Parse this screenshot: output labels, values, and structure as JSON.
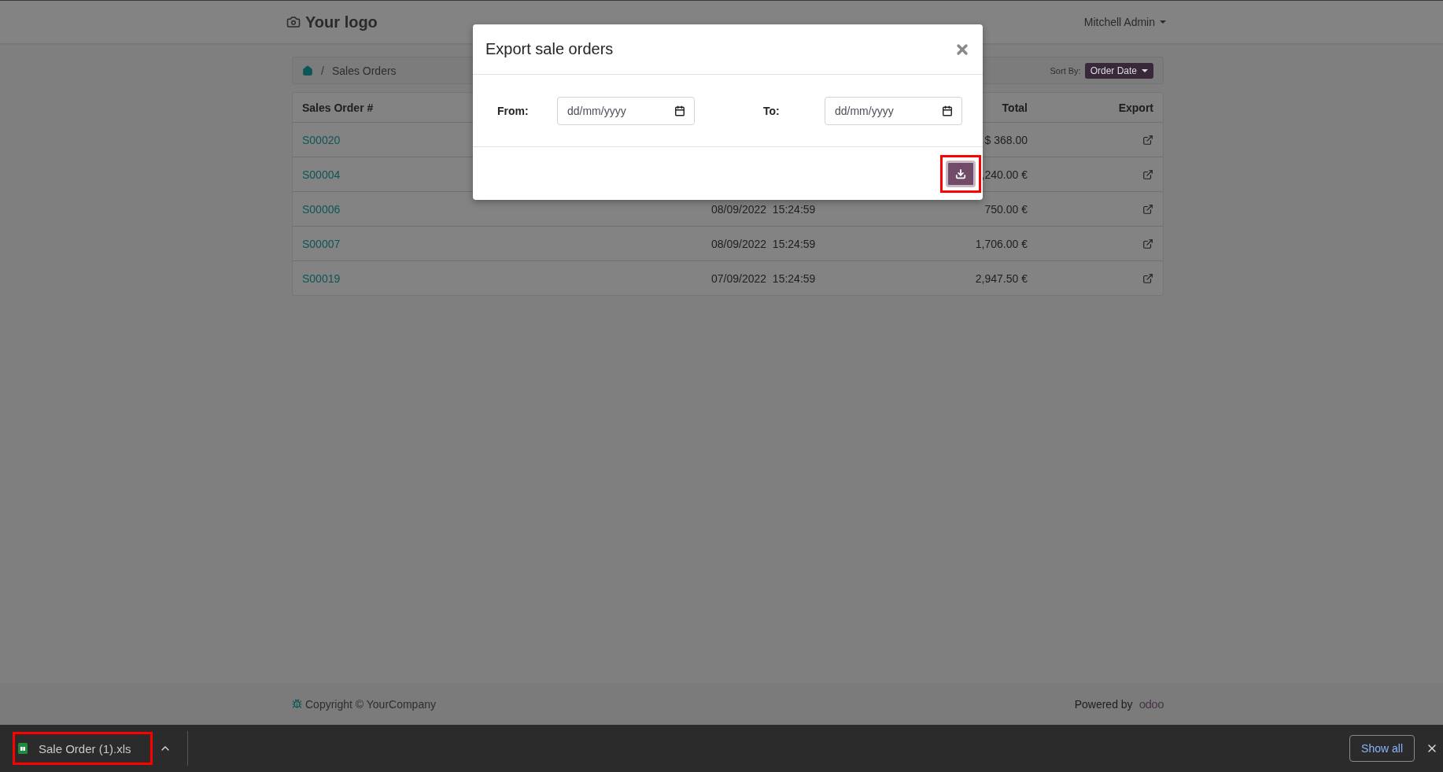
{
  "header": {
    "logo": "Your logo",
    "user": "Mitchell Admin"
  },
  "breadcrumb": {
    "separator": "/",
    "items": [
      "Sales Orders"
    ],
    "sort_label": "Sort By:",
    "sort_value": "Order Date"
  },
  "table": {
    "columns": {
      "order": "Sales Order #",
      "total": "Total",
      "export": "Export"
    },
    "rows": [
      {
        "order": "S00020",
        "total": "$ 368.00"
      },
      {
        "order": "S00004",
        "total": ",240.00 €"
      },
      {
        "order": "S00006",
        "date": "08/09/2022",
        "time": "15:24:59",
        "total": "750.00 €"
      },
      {
        "order": "S00007",
        "date": "08/09/2022",
        "time": "15:24:59",
        "total": "1,706.00 €"
      },
      {
        "order": "S00019",
        "date": "07/09/2022",
        "time": "15:24:59",
        "total": "2,947.50 €"
      }
    ]
  },
  "modal": {
    "title": "Export sale orders",
    "fields": [
      {
        "label": "From:",
        "placeholder": "dd/mm/yyyy"
      },
      {
        "label": "To:",
        "placeholder": "dd/mm/yyyy"
      }
    ],
    "download_button": {
      "highlighted": true
    }
  },
  "footer": {
    "copyright": "Copyright © YourCompany",
    "powered_by": "Powered by",
    "brand": "odoo"
  },
  "downloads": {
    "items": [
      {
        "file": "Sale Order (1).xls",
        "highlighted": true
      }
    ],
    "show_all": "Show all"
  }
}
